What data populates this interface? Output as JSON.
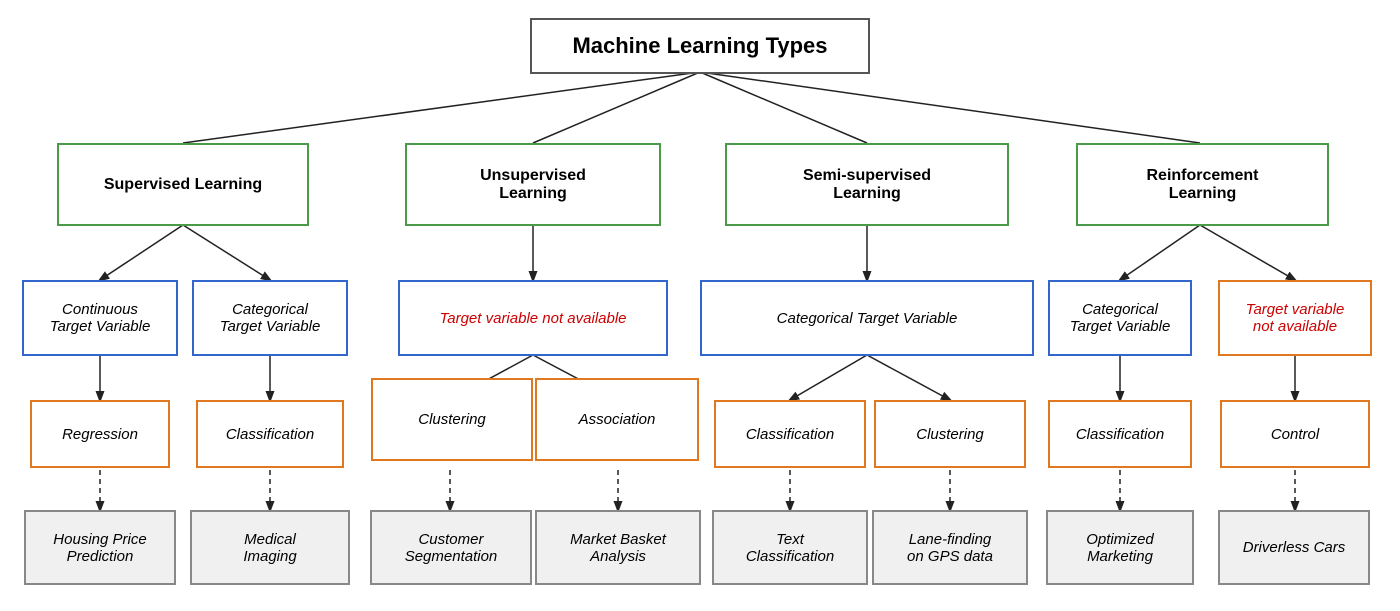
{
  "title": "Machine Learning Types",
  "nodes": {
    "root": {
      "label": "Machine Learning Types"
    },
    "supervised": {
      "label": "Supervised Learning"
    },
    "unsupervised": {
      "label": "Unsupervised\nLearning"
    },
    "semi": {
      "label": "Semi-supervised\nLearning"
    },
    "reinforcement": {
      "label": "Reinforcement\nLearning"
    },
    "continuous": {
      "label": "Continuous\nTarget Variable"
    },
    "categorical_sup": {
      "label": "Categorical\nTarget Variable"
    },
    "target_not_avail": {
      "label": "Target variable not available"
    },
    "categorical_semi": {
      "label": "Categorical Target Variable"
    },
    "categorical_reinf": {
      "label": "Categorical\nTarget Variable"
    },
    "target_not_avail_reinf": {
      "label": "Target variable\nnot available"
    },
    "regression": {
      "label": "Regression"
    },
    "classification_sup": {
      "label": "Classification"
    },
    "clustering_unsup": {
      "label": "Clustering"
    },
    "association": {
      "label": "Association"
    },
    "classification_semi": {
      "label": "Classification"
    },
    "clustering_semi": {
      "label": "Clustering"
    },
    "classification_reinf": {
      "label": "Classification"
    },
    "control": {
      "label": "Control"
    },
    "housing": {
      "label": "Housing Price\nPrediction"
    },
    "medical": {
      "label": "Medical\nImaging"
    },
    "customer_seg": {
      "label": "Customer\nSegmentation"
    },
    "market_basket": {
      "label": "Market Basket\nAnalysis"
    },
    "text_class": {
      "label": "Text\nClassification"
    },
    "lane_finding": {
      "label": "Lane-finding\non GPS data"
    },
    "opt_marketing": {
      "label": "Optimized\nMarketing"
    },
    "driverless": {
      "label": "Driverless Cars"
    }
  }
}
